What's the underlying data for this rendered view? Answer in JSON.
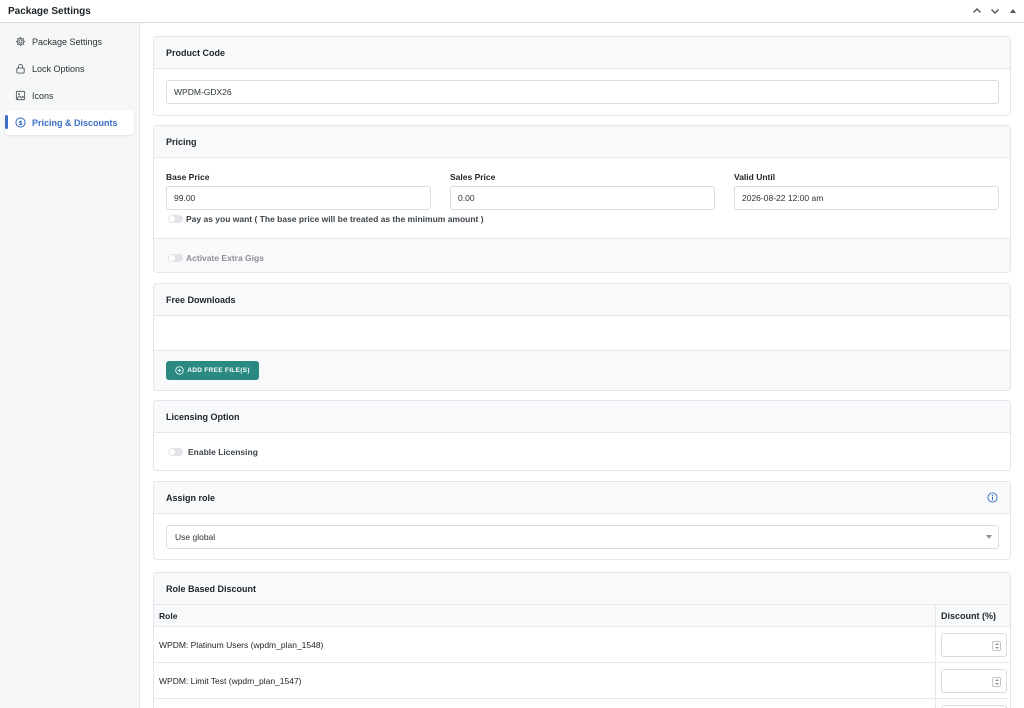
{
  "header": {
    "title": "Package Settings"
  },
  "sidebar": {
    "items": [
      {
        "label": "Package Settings",
        "icon": "gear-icon"
      },
      {
        "label": "Lock Options",
        "icon": "lock-icon"
      },
      {
        "label": "Icons",
        "icon": "image-icon"
      },
      {
        "label": "Pricing & Discounts",
        "icon": "dollar-circle-icon",
        "active": true
      }
    ]
  },
  "product_code": {
    "title": "Product Code",
    "value": "WPDM-GDX26"
  },
  "pricing": {
    "title": "Pricing",
    "base_price_label": "Base Price",
    "base_price_value": "99.00",
    "sales_price_label": "Sales Price",
    "sales_price_value": "0.00",
    "valid_until_label": "Valid Until",
    "valid_until_value": "2026-08-22 12:00 am",
    "pay_as_you_want_label": "Pay as you want ( The base price will be treated as the minimum amount )",
    "extra_gigs_label": "Activate Extra Gigs"
  },
  "free_downloads": {
    "title": "Free Downloads",
    "add_button_label": "ADD FREE FILE(S)"
  },
  "licensing": {
    "title": "Licensing Option",
    "enable_label": "Enable Licensing"
  },
  "assign_role": {
    "title": "Assign role",
    "selected": "Use global"
  },
  "role_discount": {
    "title": "Role Based Discount",
    "col_role": "Role",
    "col_discount": "Discount (%)",
    "rows": [
      {
        "role": "WPDM: Platinum Users (wpdm_plan_1548)"
      },
      {
        "role": "WPDM: Limit Test (wpdm_plan_1547)"
      }
    ]
  },
  "colors": {
    "accent": "#3a6ec5",
    "button": "#2a8a82"
  }
}
